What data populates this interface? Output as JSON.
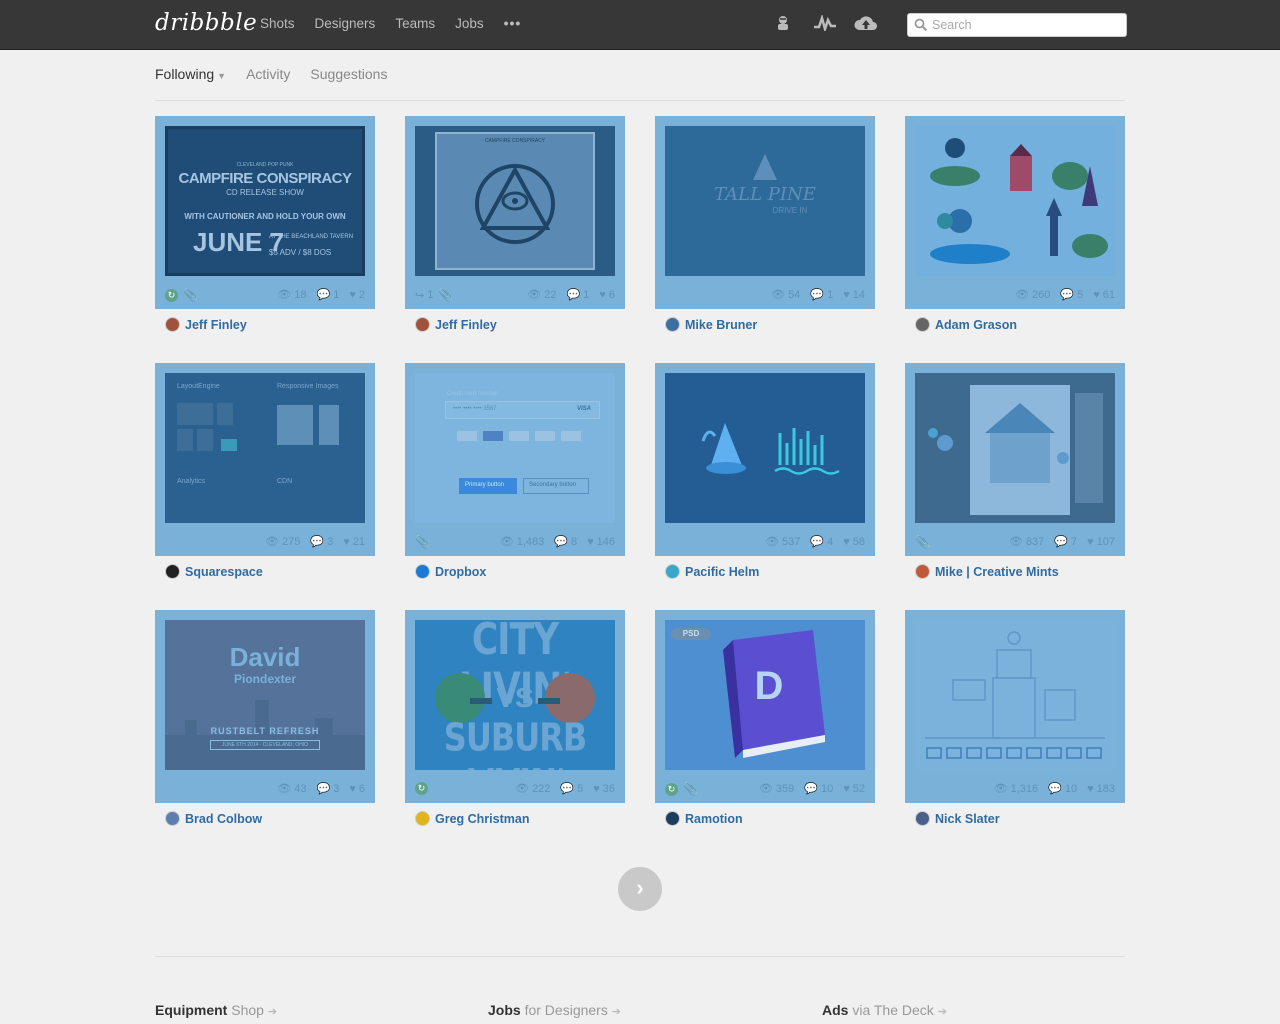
{
  "header": {
    "logo": "dribbble",
    "nav": [
      "Shots",
      "Designers",
      "Teams",
      "Jobs"
    ],
    "more": "•••",
    "icons": [
      "avatar-icon",
      "activity-icon",
      "upload-icon"
    ],
    "search_placeholder": "Search"
  },
  "subnav": {
    "items": [
      "Following",
      "Activity",
      "Suggestions"
    ],
    "active": "Following"
  },
  "shots": [
    {
      "author": "Jeff Finley",
      "views": "18",
      "comments": "1",
      "likes": "2",
      "rebound": true,
      "attachment": true,
      "rebounds": "",
      "art": {
        "lines": [
          "CLEVELAND POP PUNK",
          "CAMPFIRE CONSPIRACY",
          "CD RELEASE SHOW",
          "WITH CAUTIONER AND HOLD YOUR OWN",
          "JUNE 7",
          "AT THE BEACHLAND TAVERN",
          "$5 ADV / $8 DOS"
        ]
      }
    },
    {
      "author": "Jeff Finley",
      "views": "22",
      "comments": "1",
      "likes": "6",
      "rebound": false,
      "attachment": true,
      "rebounds": "1",
      "art": {
        "lines": [
          "CAMPFIRE CONSPIRACY"
        ]
      }
    },
    {
      "author": "Mike Bruner",
      "views": "54",
      "comments": "1",
      "likes": "14",
      "rebound": false,
      "attachment": false,
      "rebounds": "",
      "art": {
        "lines": [
          "TALL PINE",
          "DRIVE IN"
        ]
      }
    },
    {
      "author": "Adam Grason",
      "views": "260",
      "comments": "5",
      "likes": "61",
      "rebound": false,
      "attachment": false,
      "rebounds": "",
      "art": {
        "lines": []
      }
    },
    {
      "author": "Squarespace",
      "views": "275",
      "comments": "3",
      "likes": "21",
      "rebound": false,
      "attachment": false,
      "rebounds": "",
      "art": {
        "lines": [
          "LayoutEngine",
          "Responsive Images",
          "Analytics",
          "CDN"
        ]
      }
    },
    {
      "author": "Dropbox",
      "views": "1,483",
      "comments": "8",
      "likes": "146",
      "rebound": false,
      "attachment": true,
      "rebounds": "",
      "art": {
        "lines": [
          "Credit card number",
          "•••• •••• •••• 3567",
          "VISA",
          "Primary button",
          "Secondary button"
        ]
      }
    },
    {
      "author": "Pacific Helm",
      "views": "537",
      "comments": "4",
      "likes": "58",
      "rebound": false,
      "attachment": false,
      "rebounds": "",
      "art": {
        "lines": []
      }
    },
    {
      "author": "Mike | Creative Mints",
      "views": "837",
      "comments": "7",
      "likes": "107",
      "rebound": false,
      "attachment": true,
      "rebounds": "",
      "art": {
        "lines": []
      }
    },
    {
      "author": "Brad Colbow",
      "views": "43",
      "comments": "3",
      "likes": "6",
      "rebound": false,
      "attachment": false,
      "rebounds": "",
      "art": {
        "lines": [
          "David",
          "Piondexter",
          "RUSTBELT REFRESH",
          "JUNE 6TH 2014 · CLEVELAND, OHIO"
        ]
      }
    },
    {
      "author": "Greg Christman",
      "views": "222",
      "comments": "5",
      "likes": "36",
      "rebound": true,
      "attachment": false,
      "rebounds": "",
      "art": {
        "lines": [
          "CITY LIVIN'",
          "VS",
          "SUBURB LIVIN'"
        ]
      }
    },
    {
      "author": "Ramotion",
      "views": "359",
      "comments": "10",
      "likes": "52",
      "rebound": true,
      "attachment": true,
      "rebounds": "",
      "art": {
        "lines": [
          "PSD",
          "D"
        ]
      }
    },
    {
      "author": "Nick Slater",
      "views": "1,316",
      "comments": "10",
      "likes": "183",
      "rebound": false,
      "attachment": false,
      "rebounds": "",
      "art": {
        "lines": []
      }
    }
  ],
  "pager": "›",
  "footer": [
    {
      "bold": "Equipment",
      "sub": "Shop"
    },
    {
      "bold": "Jobs",
      "sub": "for Designers"
    },
    {
      "bold": "Ads",
      "sub": "via The Deck"
    }
  ],
  "colors": {
    "topbar": "#373737",
    "card_overlay": "#79b1d9",
    "link": "#2f6ca3",
    "background": "#f0f0f0"
  }
}
